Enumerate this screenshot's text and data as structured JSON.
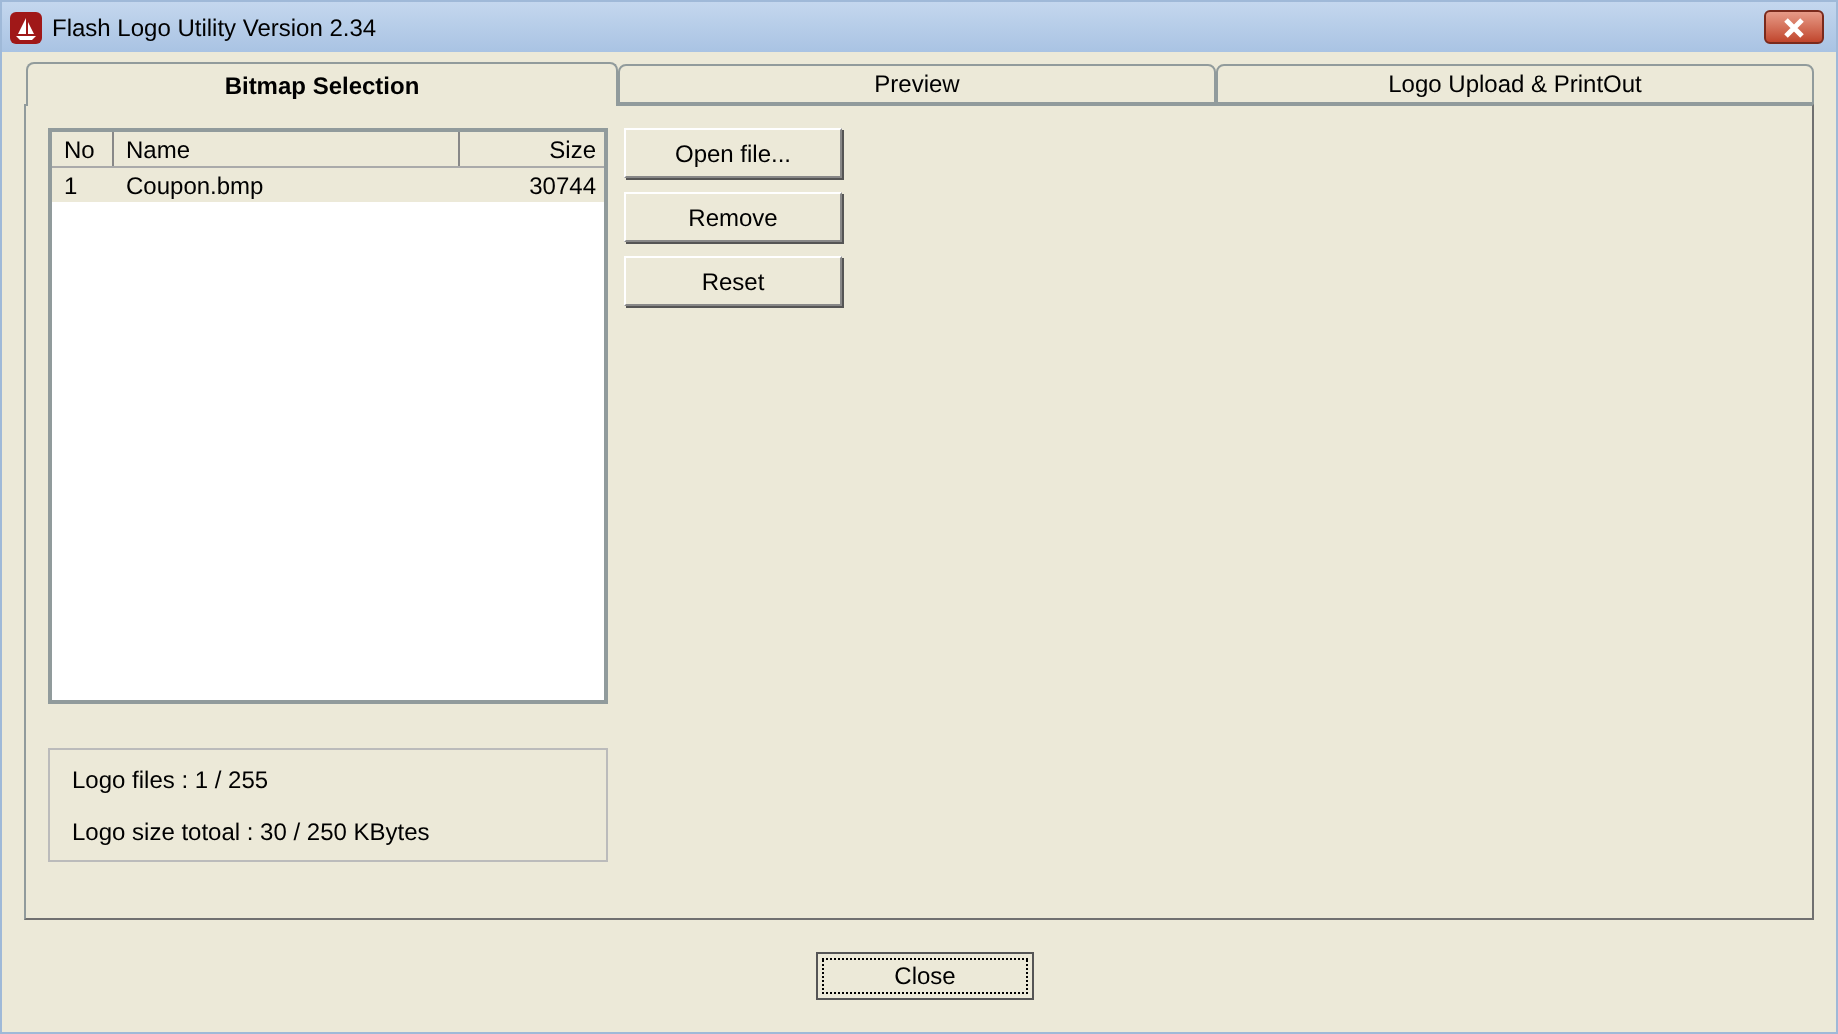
{
  "window": {
    "title": "Flash Logo Utility Version 2.34"
  },
  "tabs": [
    {
      "label": "Bitmap Selection",
      "selected": true
    },
    {
      "label": "Preview",
      "selected": false
    },
    {
      "label": "Logo Upload & PrintOut",
      "selected": false
    }
  ],
  "table": {
    "columns": [
      "No",
      "Name",
      "Size"
    ],
    "rows": [
      {
        "cells": [
          "1",
          "Coupon.bmp",
          "30744"
        ],
        "selected": true
      }
    ]
  },
  "buttons": [
    "Open file...",
    "Remove",
    "Reset"
  ],
  "info": [
    "Logo files : 1 / 255",
    "Logo size totoal : 30 / 250 KBytes"
  ],
  "close_button": "Close"
}
